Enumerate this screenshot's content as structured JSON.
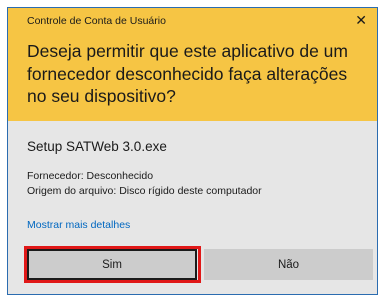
{
  "dialog": {
    "title": "Controle de Conta de Usuário",
    "close_glyph": "✕",
    "question": "Deseja permitir que este aplicativo de um fornecedor desconhecido faça alterações no seu dispositivo?",
    "program_name": "Setup SATWeb 3.0.exe",
    "publisher_line": "Fornecedor: Desconhecido",
    "origin_line": "Origem do arquivo: Disco rígido deste computador",
    "details_link": "Mostrar mais detalhes",
    "yes_label": "Sim",
    "no_label": "Não"
  },
  "colors": {
    "header_bg": "#f6c544",
    "body_bg": "#e6e6e6",
    "link": "#0067c0",
    "button_bg": "#cccccc",
    "highlight": "#e01818"
  }
}
